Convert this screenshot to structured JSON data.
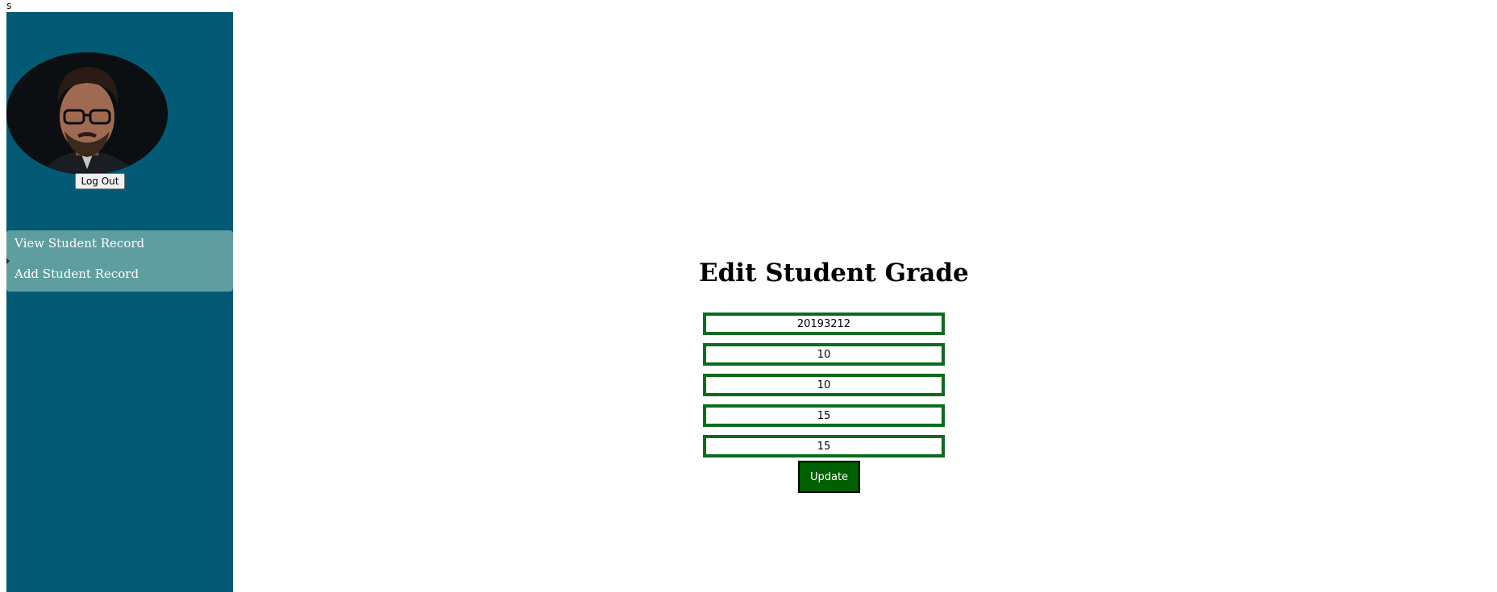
{
  "top_text": "s",
  "sidebar": {
    "logout_label": "Log Out",
    "nav_items": [
      {
        "label": "View Student Record"
      },
      {
        "label": "Add Student Record"
      }
    ]
  },
  "form": {
    "title": "Edit Student Grade",
    "fields": [
      {
        "value": "20193212"
      },
      {
        "value": "10"
      },
      {
        "value": "10"
      },
      {
        "value": "15"
      },
      {
        "value": "15"
      }
    ],
    "submit_label": "Update"
  },
  "colors": {
    "sidebar_bg": "#035a74",
    "nav_bg": "#5f9ea0",
    "field_border": "#0b6b1e",
    "button_bg": "#005f00"
  }
}
